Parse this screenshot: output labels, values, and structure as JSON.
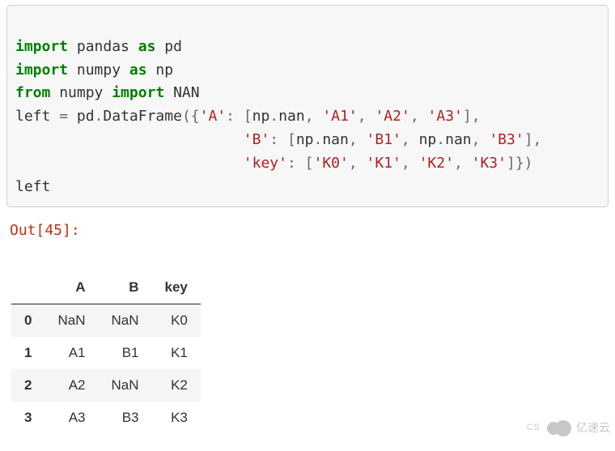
{
  "code": {
    "line1": {
      "kw1": "import",
      "mod": " pandas ",
      "kw2": "as",
      "alias": " pd"
    },
    "line2": {
      "kw1": "import",
      "mod": " numpy ",
      "kw2": "as",
      "alias": " np"
    },
    "line3": {
      "kw1": "from",
      "mod": " numpy ",
      "kw2": "import",
      "name": " NAN"
    },
    "line4": {
      "lhs": "left ",
      "eq": "=",
      "sp1": " ",
      "pd": "pd",
      "dot1": ".",
      "dfcall": "DataFrame",
      "op1": "({",
      "kA": "'A'",
      "colon": ": ",
      "lb": "[",
      "np1": "np",
      "dotn1": ".",
      "nan1": "nan",
      "c1": ", ",
      "a1": "'A1'",
      "c2": ", ",
      "a2": "'A2'",
      "c3": ", ",
      "a3": "'A3'",
      "rb": "]",
      "tc": ","
    },
    "line5": {
      "indent": "                          ",
      "kB": "'B'",
      "colon": ": ",
      "lb": "[",
      "np1": "np",
      "dotn1": ".",
      "nan1": "nan",
      "c1": ", ",
      "b1": "'B1'",
      "c2": ", ",
      "np2": "np",
      "dotn2": ".",
      "nan2": "nan",
      "c3": ", ",
      "b3": "'B3'",
      "rb": "]",
      "tc": ","
    },
    "line6": {
      "indent": "                          ",
      "kKey": "'key'",
      "colon": ": ",
      "lb": "[",
      "k0": "'K0'",
      "c1": ", ",
      "k1": "'K1'",
      "c2": ", ",
      "k2": "'K2'",
      "c3": ", ",
      "k3": "'K3'",
      "rb": "]",
      "close": "})"
    },
    "line7": {
      "txt": "left"
    }
  },
  "out_prompt": "Out[45]:",
  "table": {
    "columns": [
      "A",
      "B",
      "key"
    ],
    "index": [
      "0",
      "1",
      "2",
      "3"
    ],
    "rows": [
      [
        "NaN",
        "NaN",
        "K0"
      ],
      [
        "A1",
        "B1",
        "K1"
      ],
      [
        "A2",
        "NaN",
        "K2"
      ],
      [
        "A3",
        "B3",
        "K3"
      ]
    ]
  },
  "watermark": {
    "cs": "CS",
    "text": "亿速云"
  },
  "chart_data": {
    "type": "table",
    "title": "",
    "columns": [
      "",
      "A",
      "B",
      "key"
    ],
    "rows": [
      [
        "0",
        "NaN",
        "NaN",
        "K0"
      ],
      [
        "1",
        "A1",
        "B1",
        "K1"
      ],
      [
        "2",
        "A2",
        "NaN",
        "K2"
      ],
      [
        "3",
        "A3",
        "B3",
        "K3"
      ]
    ]
  }
}
